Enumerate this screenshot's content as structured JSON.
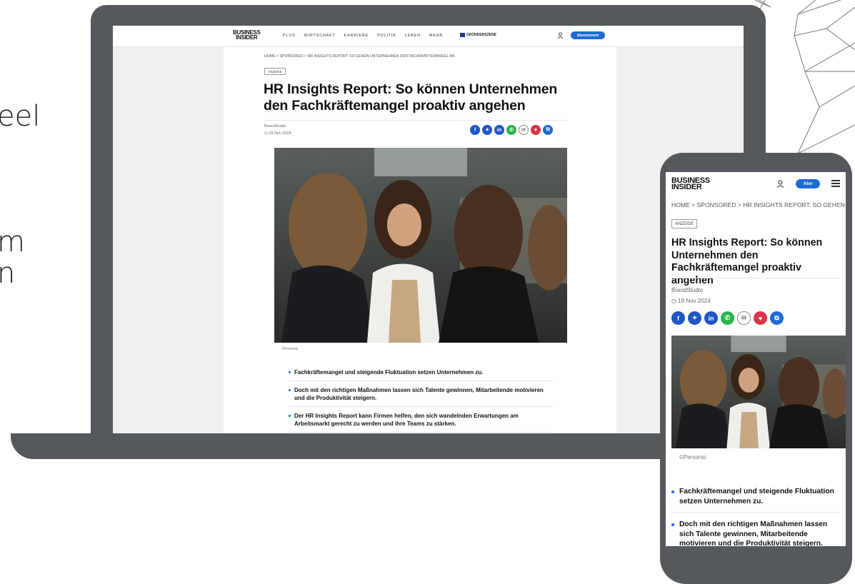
{
  "background_text": [
    "eel",
    "m",
    "n"
  ],
  "site": {
    "logo_line1": "BUSINESS",
    "logo_line2": "INSIDER",
    "nav": [
      "PLUS",
      "WIRTSCHAFT",
      "KARRIERE",
      "POLITIK",
      "LEBEN",
      "MEHR"
    ],
    "nav_partner": "GRÜNDERSZENE",
    "abo_button_desktop": "Abonnement",
    "abo_button_mobile": "Abo"
  },
  "article": {
    "breadcrumb_desktop": "HOME > SPONSORED > HR INSIGHTS REPORT: SO GEHEN UNTERNEHMEN DEN FACHKRÄFTEMANGEL AN",
    "breadcrumb_mobile": "HOME > SPONSORED > HR INSIGHTS REPORT: SO GEHEN",
    "tag": "ANZEIGE",
    "title": "HR Insights Report: So können Unternehmen den Fachkräftemangel proaktiv angehen",
    "author": "BrandStudio",
    "date": "19 Nov 2024",
    "photo_credit": "©Personio",
    "bullets": [
      "Fachkräftemangel und steigende Fluktuation setzen Unternehmen zu.",
      "Doch mit den richtigen Maßnahmen lassen sich Talente gewinnen, Mitarbeitende motivieren und die Produktivität steigern.",
      "Der HR Insights Report kann Firmen helfen, den sich wandelnden Erwartungen am Arbeitsmarkt gerecht zu werden und ihre Teams zu stärken."
    ]
  },
  "share_icons": [
    "facebook-icon",
    "twitter-icon",
    "linkedin-icon",
    "whatsapp-icon",
    "mail-icon",
    "pocket-icon",
    "copy-link-icon"
  ],
  "colors": {
    "device_frame": "#55585c",
    "accent_blue": "#1f6bd6",
    "whatsapp_green": "#2ab44a",
    "pocket_red": "#d93448"
  }
}
